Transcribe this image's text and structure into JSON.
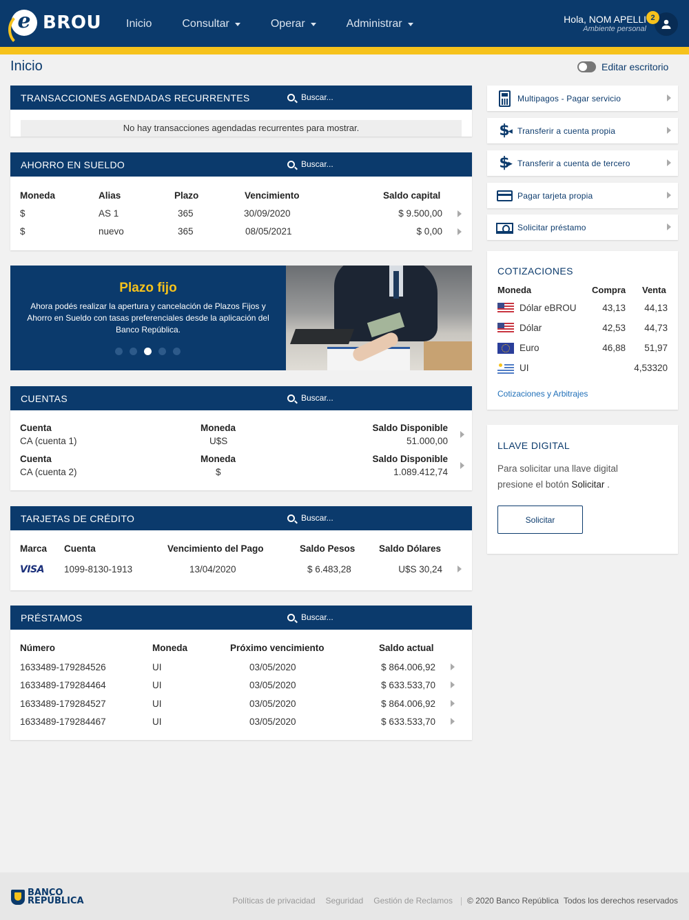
{
  "header": {
    "brand": "BROU",
    "nav": [
      "Inicio",
      "Consultar",
      "Operar",
      "Administrar"
    ],
    "user_greeting": "Hola, NOM APELLI",
    "user_sub": "Ambiente personal",
    "notifications": "2"
  },
  "page": {
    "title": "Inicio",
    "edit_desktop": "Editar escritorio",
    "search_placeholder": "Buscar..."
  },
  "recurrentes": {
    "title": "TRANSACCIONES AGENDADAS RECURRENTES",
    "empty": "No hay transacciones agendadas recurrentes para mostrar."
  },
  "ahorro": {
    "title": "AHORRO EN SUELDO",
    "headers": [
      "Moneda",
      "Alias",
      "Plazo",
      "Vencimiento",
      "Saldo capital"
    ],
    "rows": [
      [
        "$",
        "AS 1",
        "365",
        "30/09/2020",
        "$ 9.500,00"
      ],
      [
        "$",
        "nuevo",
        "365",
        "08/05/2021",
        "$ 0,00"
      ]
    ]
  },
  "banner": {
    "title": "Plazo fijo",
    "text": "Ahora podés realizar la apertura y cancelación de Plazos Fijos y Ahorro en Sueldo con tasas preferenciales desde la aplicación del Banco República."
  },
  "cuentas": {
    "title": "CUENTAS",
    "rows": [
      {
        "h1": "Cuenta",
        "v1": "CA (cuenta 1)",
        "h2": "Moneda",
        "v2": "U$S",
        "h3": "Saldo Disponible",
        "v3": "51.000,00"
      },
      {
        "h1": "Cuenta",
        "v1": "CA (cuenta 2)",
        "h2": "Moneda",
        "v2": "$",
        "h3": "Saldo Disponible",
        "v3": "1.089.412,74"
      }
    ]
  },
  "tarjetas": {
    "title": "TARJETAS DE CRÉDITO",
    "headers": [
      "Marca",
      "Cuenta",
      "Vencimiento del Pago",
      "Saldo Pesos",
      "Saldo Dólares"
    ],
    "rows": [
      {
        "brand": "VISA",
        "cuenta": "1099-8130-1913",
        "venc": "13/04/2020",
        "pesos": "$ 6.483,28",
        "dolares": "U$S 30,24"
      }
    ]
  },
  "prestamos": {
    "title": "PRÉSTAMOS",
    "headers": [
      "Número",
      "Moneda",
      "Próximo vencimiento",
      "Saldo actual"
    ],
    "rows": [
      [
        "1633489-179284526",
        "UI",
        "03/05/2020",
        "$ 864.006,92"
      ],
      [
        "1633489-179284464",
        "UI",
        "03/05/2020",
        "$ 633.533,70"
      ],
      [
        "1633489-179284527",
        "UI",
        "03/05/2020",
        "$ 864.006,92"
      ],
      [
        "1633489-179284467",
        "UI",
        "03/05/2020",
        "$ 633.533,70"
      ]
    ]
  },
  "quick_actions": [
    {
      "label": "Multipagos - Pagar servicio",
      "icon": "calculator-icon"
    },
    {
      "label": "Transferir a cuenta propia",
      "icon": "dollar-transfer-icon"
    },
    {
      "label": "Transferir a cuenta de tercero",
      "icon": "dollar-transfer-icon"
    },
    {
      "label": "Pagar tarjeta propia",
      "icon": "credit-card-icon"
    },
    {
      "label": "Solicitar préstamo",
      "icon": "banknote-icon"
    }
  ],
  "cotizaciones": {
    "title": "COTIZACIONES",
    "headers": [
      "Moneda",
      "Compra",
      "Venta"
    ],
    "rows": [
      [
        "Dólar eBROU",
        "43,13",
        "44,13"
      ],
      [
        "Dólar",
        "42,53",
        "44,73"
      ],
      [
        "Euro",
        "46,88",
        "51,97"
      ],
      [
        "UI",
        "",
        "4,53320"
      ]
    ],
    "link": "Cotizaciones y Arbitrajes"
  },
  "llave": {
    "title": "LLAVE DIGITAL",
    "text_before": "Para solicitar una llave digital presione el botón ",
    "text_bold": "Solicitar",
    "text_after": " .",
    "button": "Solicitar"
  },
  "footer": {
    "bank_line1": "BANCO",
    "bank_line2": "REPÚBLICA",
    "links": [
      "Políticas de privacidad",
      "Seguridad",
      "Gestión de Reclamos"
    ],
    "copyright": "© 2020 Banco República",
    "rights": "Todos los derechos reservados"
  },
  "colors": {
    "primary": "#0b3a6c",
    "accent": "#f6c21c",
    "link": "#1f6fb8"
  }
}
